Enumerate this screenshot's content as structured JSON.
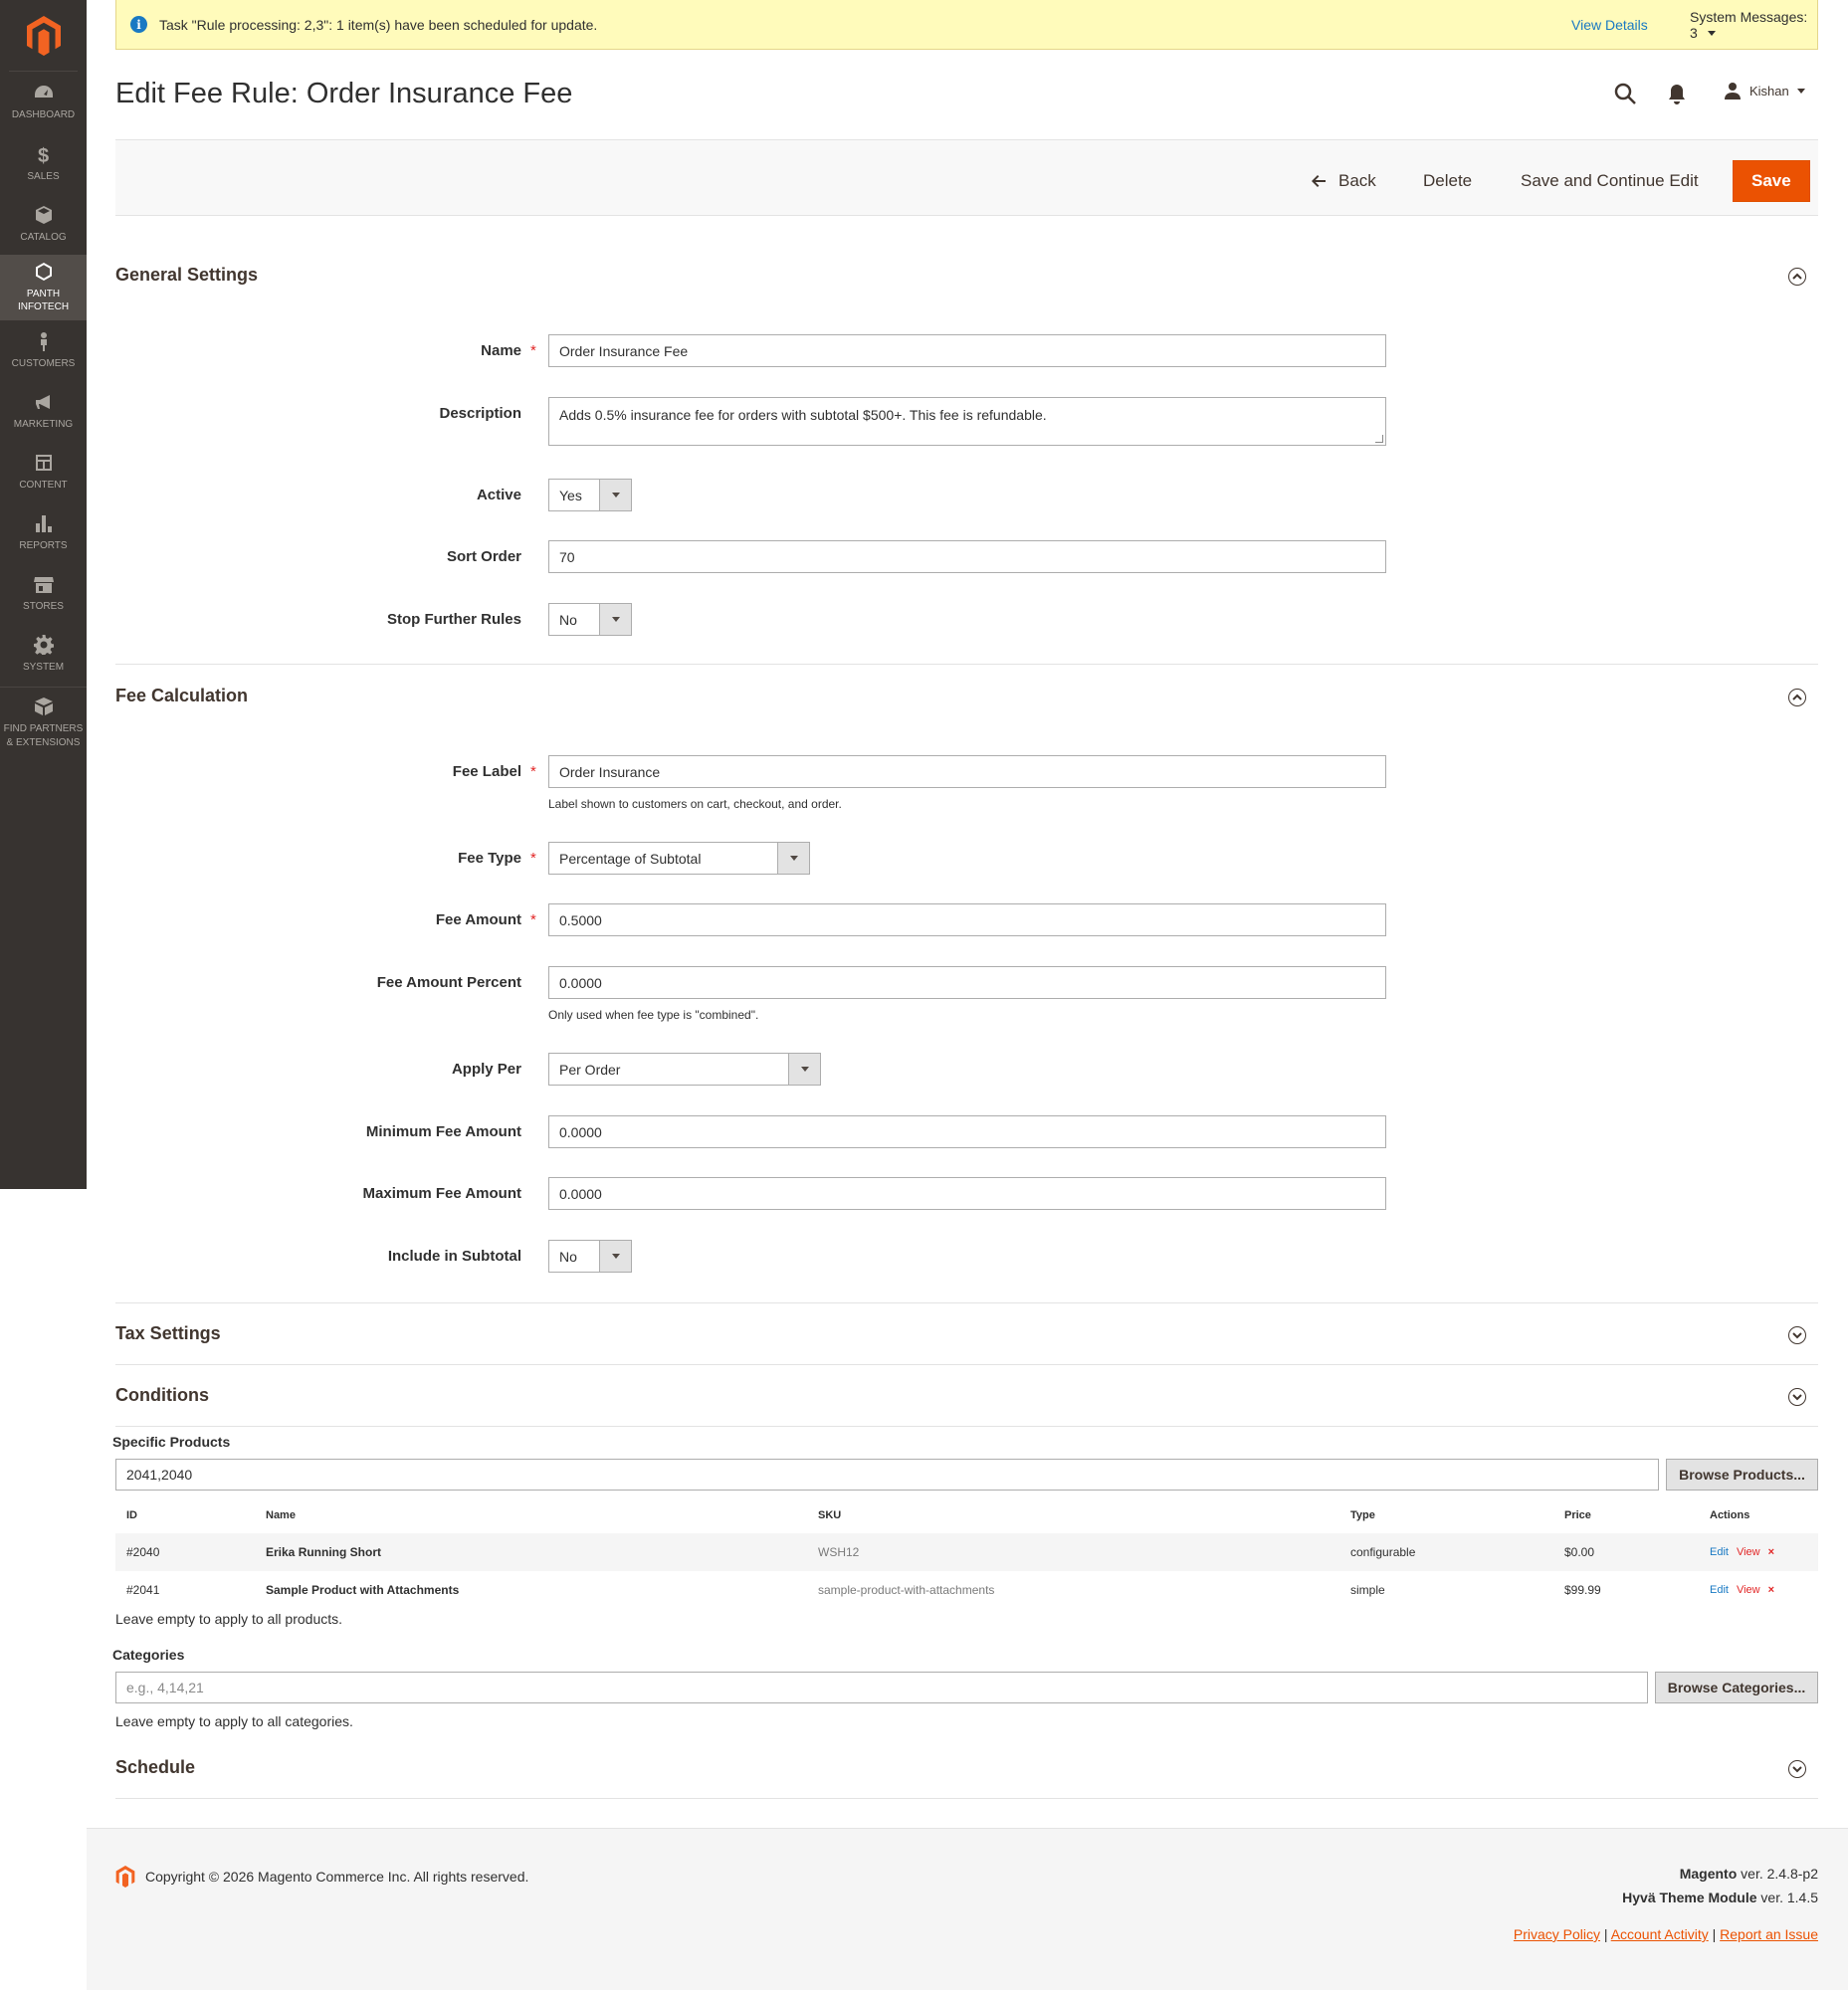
{
  "sidebar": {
    "items": [
      {
        "label": "DASHBOARD",
        "icon": "dashboard-icon"
      },
      {
        "label": "SALES",
        "icon": "dollar-icon"
      },
      {
        "label": "CATALOG",
        "icon": "cube-icon"
      },
      {
        "label": "PANTH INFOTECH",
        "icon": "hexagon-icon"
      },
      {
        "label": "CUSTOMERS",
        "icon": "person-icon"
      },
      {
        "label": "MARKETING",
        "icon": "megaphone-icon"
      },
      {
        "label": "CONTENT",
        "icon": "layout-icon"
      },
      {
        "label": "REPORTS",
        "icon": "bar-chart-icon"
      },
      {
        "label": "STORES",
        "icon": "store-icon"
      },
      {
        "label": "SYSTEM",
        "icon": "gear-icon"
      },
      {
        "label": "FIND PARTNERS & EXTENSIONS",
        "icon": "box-icon"
      }
    ]
  },
  "message": {
    "text": "Task \"Rule processing: 2,3\": 1 item(s) have been scheduled for update.",
    "view_details": "View Details",
    "system_messages": "System Messages: 3"
  },
  "header": {
    "title": "Edit Fee Rule: Order Insurance Fee",
    "user": "Kishan"
  },
  "actions": {
    "back": "Back",
    "delete": "Delete",
    "save_continue": "Save and Continue Edit",
    "save": "Save"
  },
  "general": {
    "title": "General Settings",
    "name_label": "Name",
    "name_value": "Order Insurance Fee",
    "description_label": "Description",
    "description_value": "Adds 0.5% insurance fee for orders with subtotal $500+. This fee is refundable.",
    "active_label": "Active",
    "active_value": "Yes",
    "sort_label": "Sort Order",
    "sort_value": "70",
    "stop_label": "Stop Further Rules",
    "stop_value": "No"
  },
  "fee": {
    "title": "Fee Calculation",
    "label_label": "Fee Label",
    "label_value": "Order Insurance",
    "label_note": "Label shown to customers on cart, checkout, and order.",
    "type_label": "Fee Type",
    "type_value": "Percentage of Subtotal",
    "amount_label": "Fee Amount",
    "amount_value": "0.5000",
    "percent_label": "Fee Amount Percent",
    "percent_value": "0.0000",
    "percent_note": "Only used when fee type is \"combined\".",
    "apply_label": "Apply Per",
    "apply_value": "Per Order",
    "min_label": "Minimum Fee Amount",
    "min_value": "0.0000",
    "max_label": "Maximum Fee Amount",
    "max_value": "0.0000",
    "include_label": "Include in Subtotal",
    "include_value": "No"
  },
  "tax": {
    "title": "Tax Settings"
  },
  "conditions": {
    "title": "Conditions",
    "products_label": "Specific Products",
    "products_value": "2041,2040",
    "browse_products": "Browse Products...",
    "columns": [
      "ID",
      "Name",
      "SKU",
      "Type",
      "Price",
      "Actions"
    ],
    "rows": [
      {
        "id": "#2040",
        "name": "Erika Running Short",
        "sku": "WSH12",
        "type": "configurable",
        "price": "$0.00"
      },
      {
        "id": "#2041",
        "name": "Sample Product with Attachments",
        "sku": "sample-product-with-attachments",
        "type": "simple",
        "price": "$99.99"
      }
    ],
    "row_actions": {
      "edit": "Edit",
      "view": "View",
      "remove": "×"
    },
    "products_help": "Leave empty to apply to all products.",
    "categories_label": "Categories",
    "categories_placeholder": "e.g., 4,14,21",
    "browse_categories": "Browse Categories...",
    "categories_help": "Leave empty to apply to all categories."
  },
  "schedule": {
    "title": "Schedule"
  },
  "footer": {
    "copyright": "Copyright © 2026 Magento Commerce Inc. All rights reserved.",
    "magento_name": "Magento",
    "magento_ver": " ver. 2.4.8-p2",
    "hyva_name": "Hyvä Theme Module",
    "hyva_ver": " ver. 1.4.5",
    "privacy": "Privacy Policy",
    "activity": " Account Activity",
    "report": "Report an Issue",
    "sep": " | "
  },
  "colors": {
    "accent": "#eb5202",
    "sidebar": "#373330",
    "link": "#1979c3",
    "required": "#e22626"
  }
}
